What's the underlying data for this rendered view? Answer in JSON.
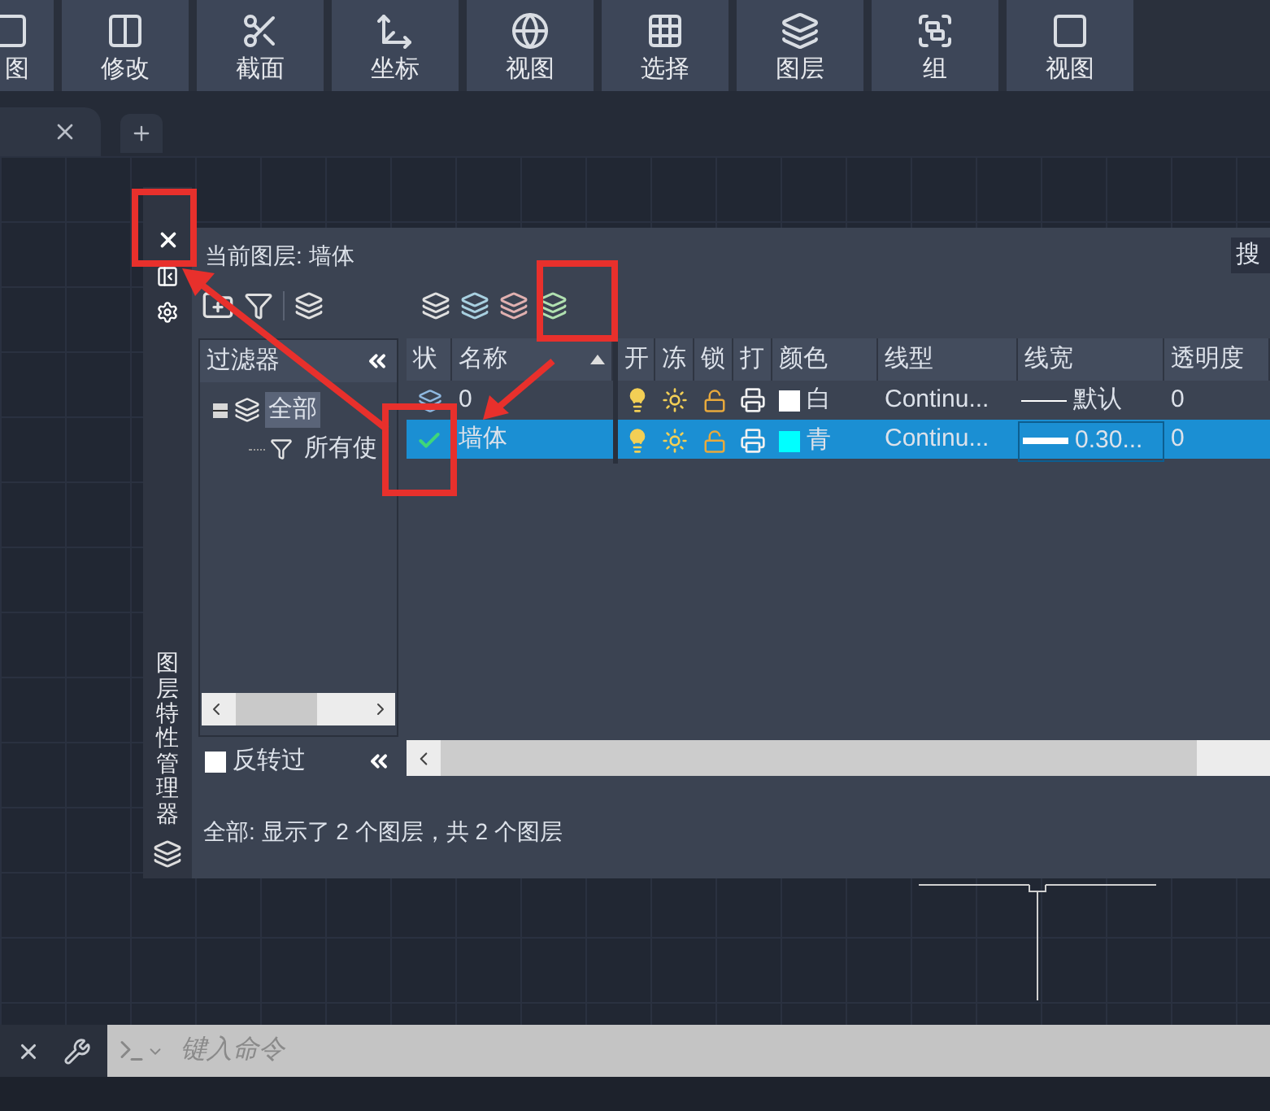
{
  "ribbon": [
    {
      "label": "图"
    },
    {
      "label": "修改"
    },
    {
      "label": "截面"
    },
    {
      "label": "坐标"
    },
    {
      "label": "视图"
    },
    {
      "label": "选择"
    },
    {
      "label": "图层"
    },
    {
      "label": "组"
    },
    {
      "label": "视图"
    }
  ],
  "palette": {
    "title": "图层特性管理器",
    "current_layer": "当前图层: 墙体",
    "search": "搜",
    "filters": {
      "heading": "过滤器",
      "tree": [
        {
          "label": "全部",
          "selected": true,
          "children": [
            {
              "label": "所有使",
              "selected": false
            }
          ]
        }
      ],
      "invert": {
        "label": "反转过",
        "checked": false
      }
    },
    "columns": [
      "状",
      "名称",
      "开",
      "冻",
      "锁",
      "打",
      "颜色",
      "线型",
      "线宽",
      "透明度"
    ],
    "layers": [
      {
        "kind": "layer",
        "name": "0",
        "on": true,
        "frozen": false,
        "locked": false,
        "plot": true,
        "color": "#ffffff",
        "color_name": "白",
        "linetype": "Continu...",
        "lineweight": {
          "label": "默认",
          "kind": "thin"
        },
        "transparency": "0",
        "selected": false
      },
      {
        "kind": "current",
        "name": "墙体",
        "on": true,
        "frozen": false,
        "locked": false,
        "plot": true,
        "color": "#00ffff",
        "color_name": "青",
        "linetype": "Continu...",
        "lineweight": {
          "label": "0.30...",
          "kind": "thick"
        },
        "transparency": "0",
        "selected": true
      }
    ],
    "status": "全部: 显示了 2 个图层，共 2 个图层"
  },
  "command": {
    "placeholder": "键入命令"
  }
}
